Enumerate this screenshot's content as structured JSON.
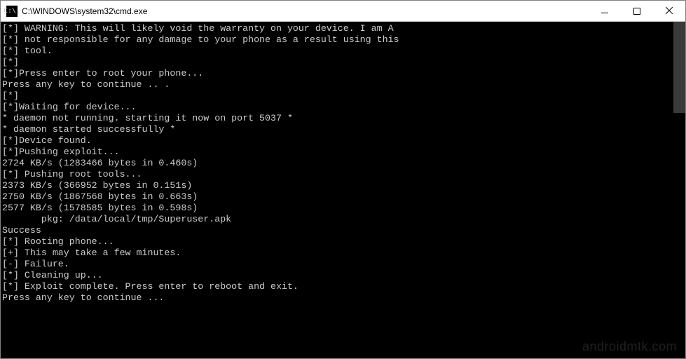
{
  "titlebar": {
    "icon_text": "C:\\.",
    "title": "C:\\WINDOWS\\system32\\cmd.exe"
  },
  "console": {
    "lines": [
      "[*] WARNING: This will likely void the warranty on your device. I am A",
      "[*] not responsible for any damage to your phone as a result using this",
      "[*] tool.",
      "[*]",
      "[*]Press enter to root your phone...",
      "Press any key to continue .. .",
      "[*]",
      "[*]Waiting for device...",
      "* daemon not running. starting it now on port 5037 *",
      "* daemon started successfully *",
      "[*]Device found.",
      "[*]Pushing exploit...",
      "2724 KB/s (1283466 bytes in 0.460s)",
      "[*] Pushing root tools...",
      "2373 KB/s (366952 bytes in 0.151s)",
      "2750 KB/s (1867568 bytes in 0.663s)",
      "2577 KB/s (1578585 bytes in 0.598s)",
      "       pkg: /data/local/tmp/Superuser.apk",
      "Success",
      "[*] Rooting phone...",
      "[+] This may take a few minutes.",
      "[-] Failure.",
      "[*] Cleaning up...",
      "[*] Exploit complete. Press enter to reboot and exit.",
      "Press any key to continue ..."
    ]
  },
  "watermark": "androidmtk.com"
}
